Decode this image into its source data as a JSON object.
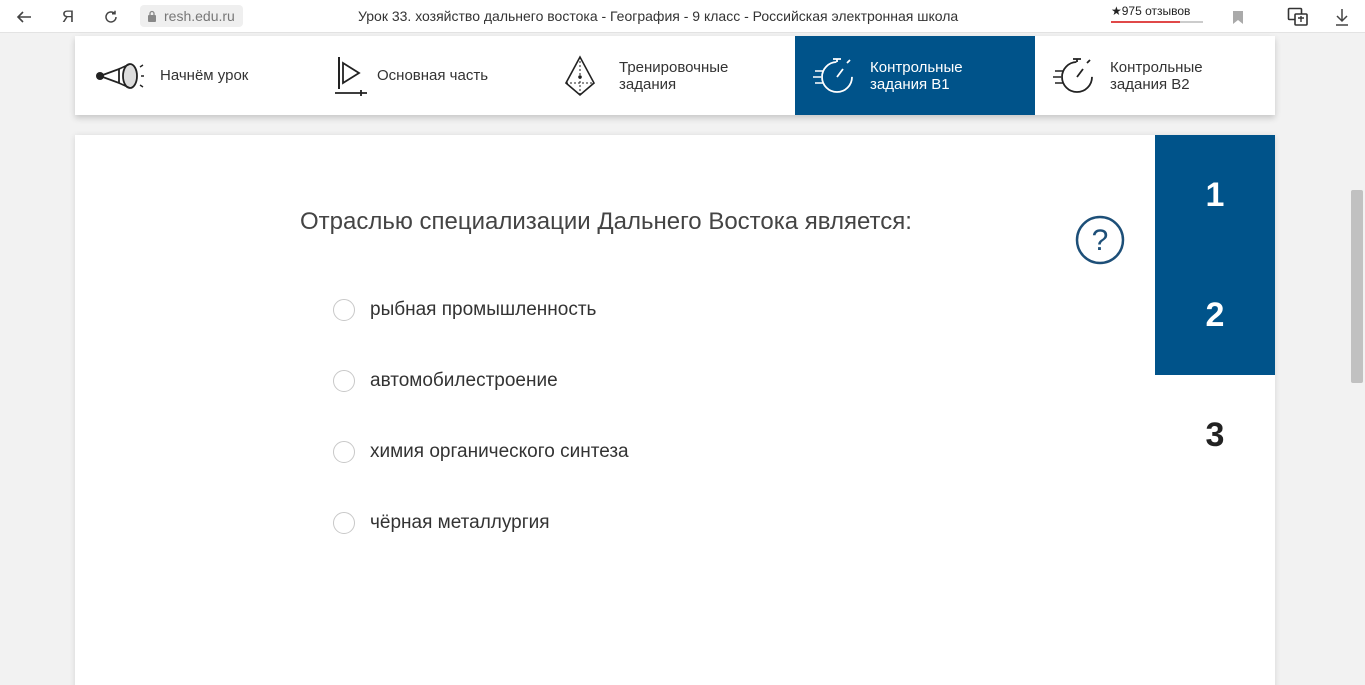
{
  "browser": {
    "back_icon": "arrow-left-icon",
    "yandex_label": "Я",
    "reload_icon": "reload-icon",
    "url": "resh.edu.ru",
    "title": "Урок 33. хозяйство дальнего востока - География - 9 класс - Российская электронная школа",
    "reviews": "★975 отзывов",
    "bookmark_icon": "bookmark-icon",
    "extension_icon": "page-translate-icon",
    "download_icon": "download-icon"
  },
  "nav": {
    "tabs": [
      {
        "label": "Начнём урок",
        "icon": "megaphone-icon",
        "active": false
      },
      {
        "label": "Основная часть",
        "icon": "play-icon",
        "active": false
      },
      {
        "label": "Тренировочные задания",
        "icon": "pyramid-icon",
        "active": false
      },
      {
        "label": "Контрольные задания В1",
        "icon": "stopwatch-icon",
        "active": true
      },
      {
        "label": "Контрольные задания В2",
        "icon": "stopwatch-icon",
        "active": false
      }
    ],
    "active_color": "#00538a"
  },
  "quiz": {
    "question": "Отраслью специализации Дальнего Востока является:",
    "help_icon": "question-circle-icon",
    "options": [
      {
        "label": "рыбная промышленность"
      },
      {
        "label": "автомобилестроение"
      },
      {
        "label": "химия органического синтеза"
      },
      {
        "label": "чёрная металлургия"
      }
    ],
    "numbers": [
      "1",
      "2",
      "3"
    ],
    "accent_color": "#00538a"
  }
}
